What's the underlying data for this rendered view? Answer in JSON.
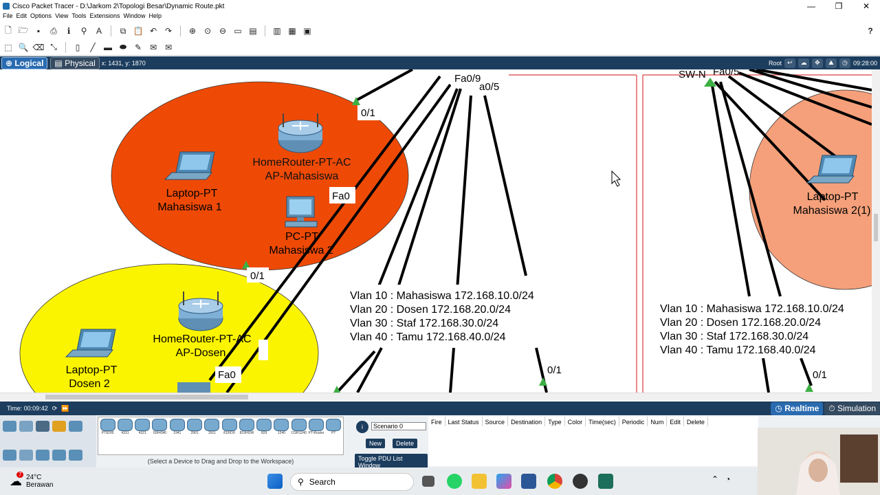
{
  "window": {
    "title": "Cisco Packet Tracer - D:\\Jarkom 2\\Topologi Besar\\Dynamic Route.pkt",
    "minimize": "—",
    "maximize": "❐",
    "close": "✕"
  },
  "menu": [
    "File",
    "Edit",
    "Options",
    "View",
    "Tools",
    "Extensions",
    "Window",
    "Help"
  ],
  "help_icon": "?",
  "modebar": {
    "logical": "Logical",
    "physical": "Physical",
    "coords": "x: 1431, y: 1870",
    "root": "Root",
    "clock": "09:28:00"
  },
  "workspace": {
    "left_labels": {
      "fa09": "Fa0/9",
      "fa05": "a0/5",
      "port01_top": "0/1",
      "router1_name": "HomeRouter-PT-AC",
      "router1_sub": "AP-Mahasiswa",
      "laptop1_type": "Laptop-PT",
      "laptop1_name": "Mahasiswa 1",
      "fa0_1": "Fa0",
      "pc_type": "PC-PT",
      "pc_name": "Mahasiswa 2",
      "port01_mid": "0/1",
      "router2_name": "HomeRouter-PT-AC",
      "router2_sub": "AP-Dosen",
      "laptop2_type": "Laptop-PT",
      "laptop2_name": "Dosen 2",
      "fa0_2": "Fa0",
      "port01_bottom": "0/1"
    },
    "vlan_left": [
      "Vlan 10 : Mahasiswa 172.168.10.0/24",
      "Vlan 20 : Dosen 172.168.20.0/24",
      "Vlan 30 : Staf 172.168.30.0/24",
      "Vlan 40 : Tamu 172.168.40.0/24"
    ],
    "right_labels": {
      "switch": "SW-N",
      "switch_port": "Fa0/5",
      "laptop_type": "Laptop-PT",
      "laptop_name": "Mahasiswa 2(1)",
      "port01": "0/1"
    },
    "vlan_right": [
      "Vlan 10 : Mahasiswa 172.168.10.0/24",
      "Vlan 20 : Dosen 172.168.20.0/24",
      "Vlan 30 : Staf 172.168.30.0/24",
      "Vlan 40 : Tamu 172.168.40.0/24"
    ],
    "colors": {
      "ellipse_orange": "#ee4a06",
      "ellipse_yellow": "#fbf400",
      "ellipse_salmon": "#f5a07a",
      "cable": "#000000",
      "link_up": "#3cb043"
    }
  },
  "timebar": {
    "time": "Time: 00:09:42",
    "realtime": "Realtime",
    "simulation": "Simulation"
  },
  "devices": [
    "PT8200",
    "4331",
    "4321",
    "ISR4340",
    "1941",
    "2901",
    "2911",
    "819IOX",
    "819HGW",
    "829",
    "1240",
    "CGR1240",
    "PT-Router",
    "PT"
  ],
  "device_hint": "(Select a Device to Drag and Drop to the Workspace)",
  "pdu": {
    "scenario": "Scenario 0",
    "new": "New",
    "delete": "Delete",
    "toggle": "Toggle PDU List Window"
  },
  "pdu_columns": [
    "Fire",
    "Last Status",
    "Source",
    "Destination",
    "Type",
    "Color",
    "Time(sec)",
    "Periodic",
    "Num",
    "Edit",
    "Delete"
  ],
  "taskbar": {
    "temp": "24°C",
    "weather": "Berawan",
    "alert": "7",
    "search": "Search"
  }
}
